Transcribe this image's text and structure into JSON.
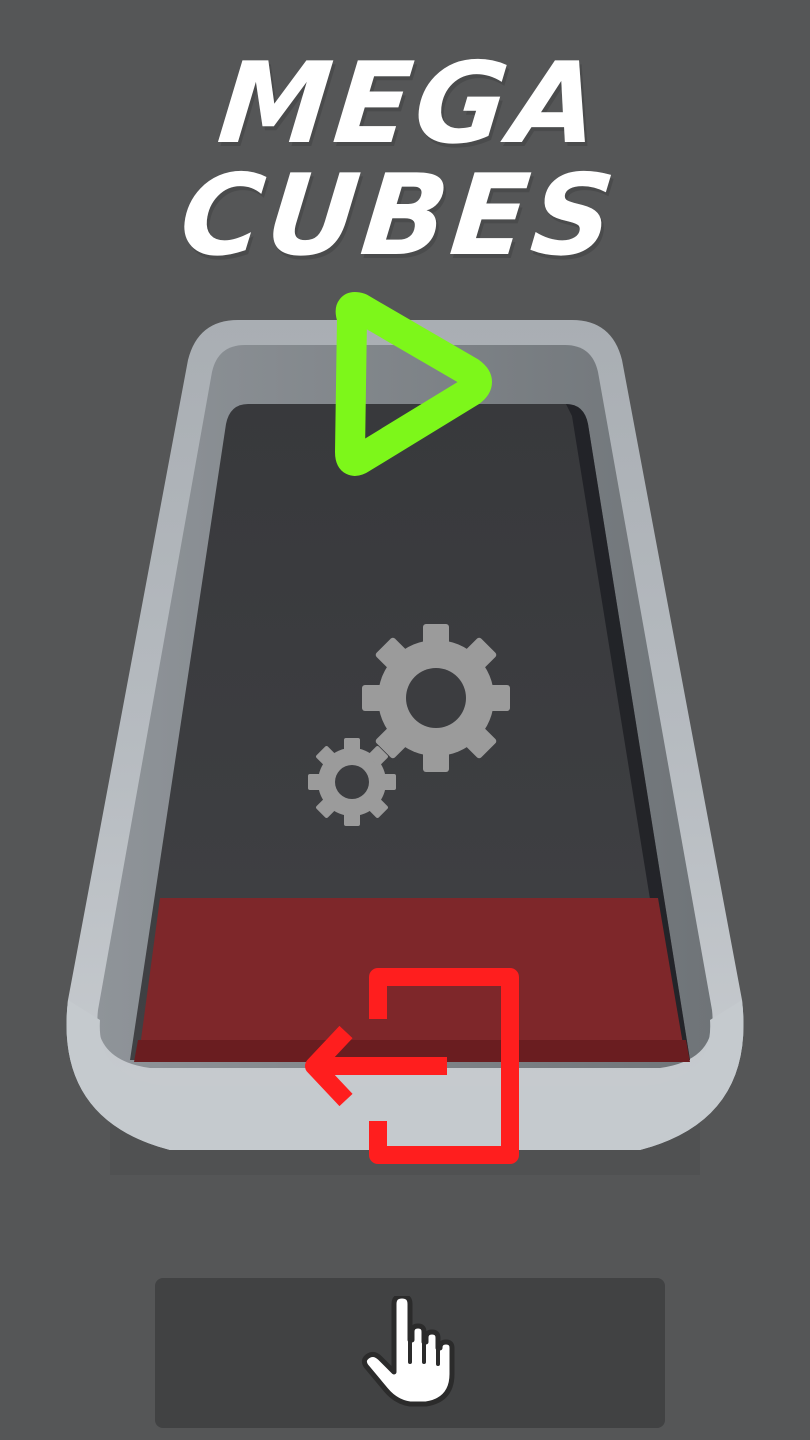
{
  "title": "MEGA CUBES",
  "colors": {
    "background": "#555657",
    "tray_frame": "#b9bfc4",
    "tray_floor": "#3c3d40",
    "exit_zone": "#7e272a",
    "play": "#7df71a",
    "settings": "#9a9a9a",
    "exit": "#ff1e1e",
    "tap_panel": "#414243"
  },
  "buttons": {
    "play": {
      "icon": "play-triangle-icon"
    },
    "settings": {
      "icon": "gears-icon"
    },
    "exit": {
      "icon": "exit-door-icon"
    },
    "tap": {
      "icon": "tap-hand-icon"
    }
  }
}
